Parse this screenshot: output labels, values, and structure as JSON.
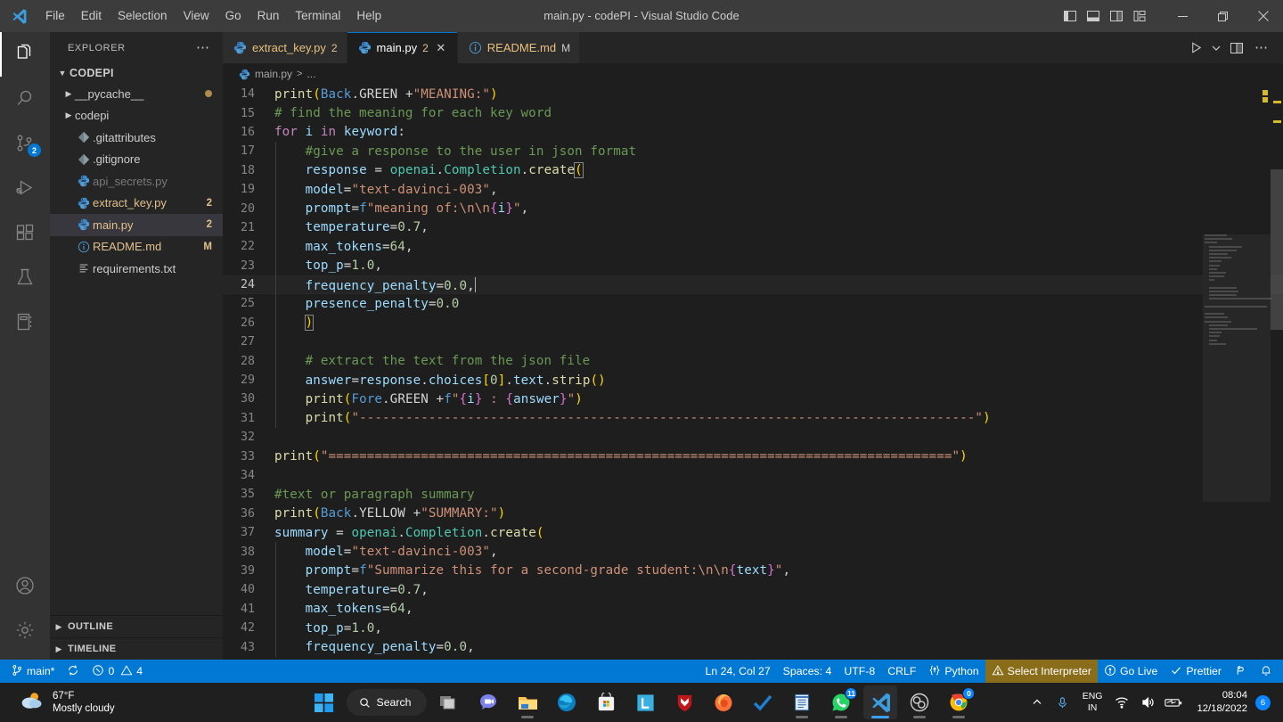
{
  "titlebar": {
    "title": "main.py - codePI - Visual Studio Code",
    "menus": [
      "File",
      "Edit",
      "Selection",
      "View",
      "Go",
      "Run",
      "Terminal",
      "Help"
    ],
    "layout_icons": [
      "toggle-primary-sidebar-icon",
      "toggle-panel-icon",
      "toggle-secondary-sidebar-icon",
      "customize-layout-icon"
    ],
    "window_controls": [
      "minimize",
      "restore",
      "close"
    ]
  },
  "activitybar": {
    "items": [
      {
        "name": "explorer",
        "active": true,
        "badge": ""
      },
      {
        "name": "search",
        "active": false,
        "badge": ""
      },
      {
        "name": "source-control",
        "active": false,
        "badge": "2"
      },
      {
        "name": "run-and-debug",
        "active": false,
        "badge": ""
      },
      {
        "name": "extensions",
        "active": false,
        "badge": ""
      },
      {
        "name": "testing",
        "active": false,
        "badge": ""
      },
      {
        "name": "notebook",
        "active": false,
        "badge": ""
      }
    ],
    "bottom": [
      {
        "name": "accounts"
      },
      {
        "name": "manage-settings"
      }
    ]
  },
  "sidebar": {
    "header": "EXPLORER",
    "root": "CODEPI",
    "files": [
      {
        "label": "__pycache__",
        "type": "folder",
        "badge": "",
        "modified_dot": true,
        "color": "#cccccc",
        "selected": false
      },
      {
        "label": "codepi",
        "type": "folder",
        "badge": "",
        "modified_dot": false,
        "color": "#cccccc",
        "selected": false
      },
      {
        "label": ".gitattributes",
        "type": "git",
        "badge": "",
        "modified_dot": false,
        "color": "#cccccc",
        "selected": false
      },
      {
        "label": ".gitignore",
        "type": "git",
        "badge": "",
        "modified_dot": false,
        "color": "#cccccc",
        "selected": false
      },
      {
        "label": "api_secrets.py",
        "type": "python",
        "badge": "",
        "modified_dot": false,
        "color": "#7a7a7a",
        "selected": false
      },
      {
        "label": "extract_key.py",
        "type": "python",
        "badge": "2",
        "modified_dot": false,
        "color": "#e2c08d",
        "selected": false
      },
      {
        "label": "main.py",
        "type": "python",
        "badge": "2",
        "modified_dot": false,
        "color": "#e2c08d",
        "selected": true
      },
      {
        "label": "README.md",
        "type": "markdown",
        "badge": "M",
        "modified_dot": false,
        "color": "#e2c08d",
        "selected": false
      },
      {
        "label": "requirements.txt",
        "type": "text",
        "badge": "",
        "modified_dot": false,
        "color": "#cccccc",
        "selected": false
      }
    ],
    "sections": [
      "OUTLINE",
      "TIMELINE"
    ]
  },
  "editor": {
    "tabs": [
      {
        "label": "extract_key.py",
        "icon": "python-icon",
        "badge": "2",
        "active": false,
        "closable": false,
        "modified": ""
      },
      {
        "label": "main.py",
        "icon": "python-icon",
        "badge": "2",
        "active": true,
        "closable": true,
        "modified": ""
      },
      {
        "label": "README.md",
        "icon": "info-icon",
        "badge": "",
        "active": false,
        "closable": false,
        "modified": "M"
      }
    ],
    "actions": [
      "run-python-file-icon",
      "run-dropdown-chevron-icon",
      "split-editor-icon",
      "more-actions-icon"
    ],
    "breadcrumb": {
      "file": "main.py",
      "separator": ">",
      "rest": "..."
    },
    "first_line": 14,
    "cursor_line": 24,
    "lines": [
      {
        "n": 14,
        "indent": 0,
        "html": "<span class='fn'>print</span><span class='p1'>(</span><span class='kb'>Back</span><span class='op'>.GREEN </span><span class='op'>+</span><span class='st'>\"MEANING:\"</span><span class='p1'>)</span>"
      },
      {
        "n": 15,
        "indent": 0,
        "html": "<span class='cm'># find the meaning for each key word</span>"
      },
      {
        "n": 16,
        "indent": 0,
        "html": "<span class='k'>for</span> <span class='vr'>i</span> <span class='k'>in</span> <span class='vr'>keyword</span><span class='op'>:</span>"
      },
      {
        "n": 17,
        "indent": 1,
        "html": "<span class='cm'>#give a response to the user in json format</span>"
      },
      {
        "n": 18,
        "indent": 1,
        "html": "<span class='vr'>response</span> <span class='op'>=</span> <span class='cl'>openai</span><span class='op'>.</span><span class='cl'>Completion</span><span class='op'>.</span><span class='fn'>create</span><span class='p1 bracket-box'>(</span>"
      },
      {
        "n": 19,
        "indent": 1,
        "html": "<span class='vr'>model</span><span class='op'>=</span><span class='st'>\"text-davinci-003\"</span><span class='op'>,</span>"
      },
      {
        "n": 20,
        "indent": 1,
        "html": "<span class='vr'>prompt</span><span class='op'>=</span><span class='kb'>f</span><span class='st'>\"meaning of:\\n\\n</span><span class='p2'>{</span><span class='vr'>i</span><span class='p2'>}</span><span class='st'>\"</span><span class='op'>,</span>"
      },
      {
        "n": 21,
        "indent": 1,
        "html": "<span class='vr'>temperature</span><span class='op'>=</span><span class='nu'>0.7</span><span class='op'>,</span>"
      },
      {
        "n": 22,
        "indent": 1,
        "html": "<span class='vr'>max_tokens</span><span class='op'>=</span><span class='nu'>64</span><span class='op'>,</span>"
      },
      {
        "n": 23,
        "indent": 1,
        "html": "<span class='vr'>top_p</span><span class='op'>=</span><span class='nu'>1.0</span><span class='op'>,</span>"
      },
      {
        "n": 24,
        "indent": 1,
        "html": "<span class='vr'>frequency_penalty</span><span class='op'>=</span><span class='nu'>0.0</span><span class='op'>,</span><span class='caret'></span>",
        "current": true
      },
      {
        "n": 25,
        "indent": 1,
        "html": "<span class='vr'>presence_penalty</span><span class='op'>=</span><span class='nu'>0.0</span>"
      },
      {
        "n": 26,
        "indent": 1,
        "html": "<span class='p1 bracket-box'>)</span>"
      },
      {
        "n": 27,
        "indent": 1,
        "html": ""
      },
      {
        "n": 28,
        "indent": 1,
        "html": "<span class='cm'># extract the text from the json file</span>"
      },
      {
        "n": 29,
        "indent": 1,
        "html": "<span class='vr'>answer</span><span class='op'>=</span><span class='vr'>response</span><span class='op'>.</span><span class='vr'>choices</span><span class='p1'>[</span><span class='nu'>0</span><span class='p1'>]</span><span class='op'>.</span><span class='vr'>text</span><span class='op'>.</span><span class='fn'>strip</span><span class='p1'>()</span>"
      },
      {
        "n": 30,
        "indent": 1,
        "html": "<span class='fn'>print</span><span class='p1'>(</span><span class='kb'>Fore</span><span class='op'>.GREEN </span><span class='op'>+</span><span class='kb'>f</span><span class='st'>\"</span><span class='p2'>{</span><span class='vr'>i</span><span class='p2'>}</span><span class='st'> : </span><span class='p2'>{</span><span class='vr'>answer</span><span class='p2'>}</span><span class='st'>\"</span><span class='p1'>)</span>"
      },
      {
        "n": 31,
        "indent": 1,
        "html": "<span class='fn'>print</span><span class='p1'>(</span><span class='st'>\"--------------------------------------------------------------------------------\"</span><span class='p1'>)</span>"
      },
      {
        "n": 32,
        "indent": 0,
        "html": ""
      },
      {
        "n": 33,
        "indent": 0,
        "html": "<span class='fn'>print</span><span class='p1'>(</span><span class='st'>\"=================================================================================\"</span><span class='p1'>)</span>"
      },
      {
        "n": 34,
        "indent": 0,
        "html": ""
      },
      {
        "n": 35,
        "indent": 0,
        "html": "<span class='cm'>#text or paragraph summary</span>"
      },
      {
        "n": 36,
        "indent": 0,
        "html": "<span class='fn'>print</span><span class='p1'>(</span><span class='kb'>Back</span><span class='op'>.YELLOW </span><span class='op'>+</span><span class='st'>\"SUMMARY:\"</span><span class='p1'>)</span>"
      },
      {
        "n": 37,
        "indent": 0,
        "html": "<span class='vr'>summary</span> <span class='op'>=</span> <span class='cl'>openai</span><span class='op'>.</span><span class='cl'>Completion</span><span class='op'>.</span><span class='fn'>create</span><span class='p1'>(</span>"
      },
      {
        "n": 38,
        "indent": 1,
        "html": "<span class='vr'>model</span><span class='op'>=</span><span class='st'>\"text-davinci-003\"</span><span class='op'>,</span>"
      },
      {
        "n": 39,
        "indent": 1,
        "html": "<span class='vr'>prompt</span><span class='op'>=</span><span class='kb'>f</span><span class='st'>\"Summarize this for a second-grade student:\\n\\n</span><span class='p2'>{</span><span class='vr'>text</span><span class='p2'>}</span><span class='st'>\"</span><span class='op'>,</span>"
      },
      {
        "n": 40,
        "indent": 1,
        "html": "<span class='vr'>temperature</span><span class='op'>=</span><span class='nu'>0.7</span><span class='op'>,</span>"
      },
      {
        "n": 41,
        "indent": 1,
        "html": "<span class='vr'>max_tokens</span><span class='op'>=</span><span class='nu'>64</span><span class='op'>,</span>"
      },
      {
        "n": 42,
        "indent": 1,
        "html": "<span class='vr'>top_p</span><span class='op'>=</span><span class='nu'>1.0</span><span class='op'>,</span>"
      },
      {
        "n": 43,
        "indent": 1,
        "html": "<span class='vr'>frequency_penalty</span><span class='op'>=</span><span class='nu'>0.0</span><span class='op'>,</span>"
      }
    ]
  },
  "statusbar": {
    "left": [
      {
        "name": "branch",
        "icon": "source-control-icon",
        "label": "main*"
      },
      {
        "name": "sync",
        "icon": "sync-icon",
        "label": ""
      },
      {
        "name": "problems",
        "icon": "error-warning-icon",
        "label": "0",
        "label2": "4"
      }
    ],
    "right": [
      {
        "name": "cursor-position",
        "label": "Ln 24, Col 27"
      },
      {
        "name": "indentation",
        "label": "Spaces: 4"
      },
      {
        "name": "encoding",
        "label": "UTF-8"
      },
      {
        "name": "eol",
        "label": "CRLF"
      },
      {
        "name": "language-mode",
        "label": "Python"
      },
      {
        "name": "select-interpreter",
        "label": "Select Interpreter",
        "highlight": true
      },
      {
        "name": "go-live",
        "label": "Go Live"
      },
      {
        "name": "prettier",
        "label": "Prettier"
      },
      {
        "name": "remote-window",
        "label": ""
      },
      {
        "name": "notifications",
        "label": ""
      }
    ]
  },
  "taskbar": {
    "weather": {
      "temp": "67°F",
      "desc": "Mostly cloudy"
    },
    "search_label": "Search",
    "apps": [
      {
        "name": "task-view",
        "running": false,
        "badge": ""
      },
      {
        "name": "chat",
        "running": false,
        "badge": ""
      },
      {
        "name": "file-explorer",
        "running": true,
        "badge": ""
      },
      {
        "name": "microsoft-edge",
        "running": false,
        "badge": ""
      },
      {
        "name": "microsoft-store",
        "running": false,
        "badge": ""
      },
      {
        "name": "lightshot",
        "running": false,
        "badge": ""
      },
      {
        "name": "mcafee",
        "running": false,
        "badge": ""
      },
      {
        "name": "firefox",
        "running": true,
        "badge": ""
      },
      {
        "name": "todo",
        "running": false,
        "badge": ""
      },
      {
        "name": "notepad",
        "running": true,
        "badge": ""
      },
      {
        "name": "whatsapp",
        "running": true,
        "badge": "11"
      },
      {
        "name": "visual-studio-code",
        "running": true,
        "badge": "",
        "active": true
      },
      {
        "name": "obs-studio",
        "running": true,
        "badge": ""
      },
      {
        "name": "google-chrome",
        "running": true,
        "badge": "0"
      }
    ],
    "tray": {
      "language": {
        "line1": "ENG",
        "line2": "IN"
      },
      "icons": [
        "show-hidden-icons",
        "microphone-icon",
        "wifi-icon",
        "volume-icon",
        "battery-icon"
      ],
      "time": "08:04",
      "date": "12/18/2022",
      "notification_count": "6"
    }
  }
}
